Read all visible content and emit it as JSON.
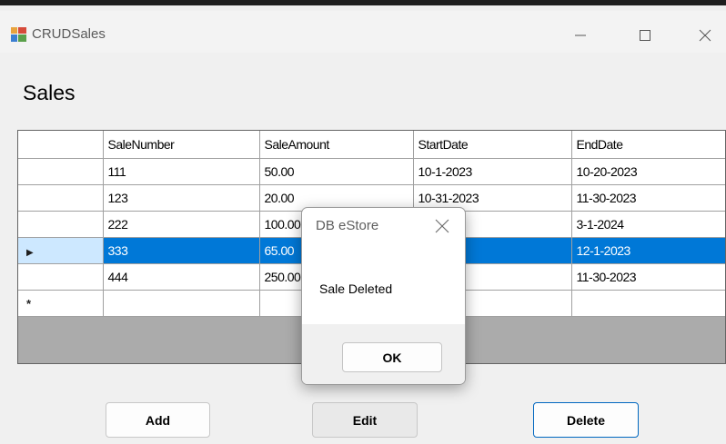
{
  "window": {
    "title": "CRUDSales"
  },
  "page": {
    "heading": "Sales"
  },
  "grid": {
    "columns": [
      "SaleNumber",
      "SaleAmount",
      "StartDate",
      "EndDate"
    ],
    "rows": [
      {
        "sale_number": "111",
        "sale_amount": "50.00",
        "start_date": "10-1-2023",
        "end_date": "10-20-2023"
      },
      {
        "sale_number": "123",
        "sale_amount": "20.00",
        "start_date": "10-31-2023",
        "end_date": "11-30-2023"
      },
      {
        "sale_number": "222",
        "sale_amount": "100.00",
        "start_date": "24",
        "end_date": "3-1-2024"
      },
      {
        "sale_number": "333",
        "sale_amount": "65.00",
        "start_date": "023",
        "end_date": "12-1-2023"
      },
      {
        "sale_number": "444",
        "sale_amount": "250.00",
        "start_date": "023",
        "end_date": "11-30-2023"
      }
    ],
    "current_row_marker": "▶",
    "new_row_marker": "*",
    "selected_row_index": 3,
    "selection_color": "#0078d7"
  },
  "buttons": {
    "add": "Add",
    "edit": "Edit",
    "delete": "Delete"
  },
  "dialog": {
    "title": "DB eStore",
    "message": "Sale Deleted",
    "ok": "OK"
  },
  "icons": {
    "app": "form-app-icon",
    "minimize": "minimize-icon",
    "maximize": "maximize-icon",
    "close": "close-icon"
  }
}
